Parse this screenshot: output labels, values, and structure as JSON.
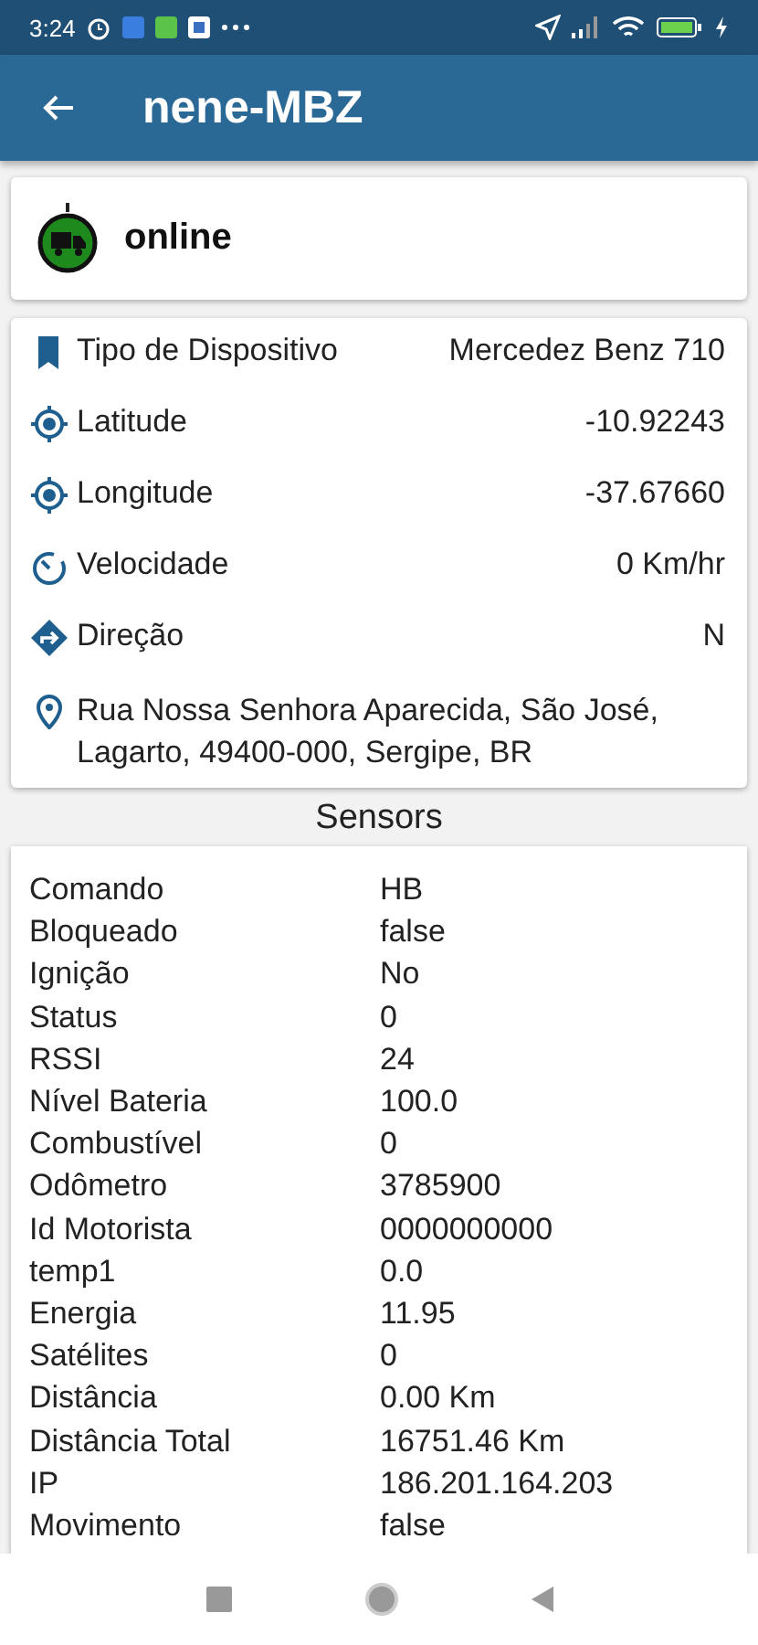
{
  "status_bar": {
    "time": "3:24"
  },
  "app_bar": {
    "title": "nene-MBZ"
  },
  "status_card": {
    "status": "online",
    "online": true
  },
  "details": [
    {
      "kind": "bookmark",
      "label": "Tipo de Dispositivo",
      "value": "Mercedez Benz 710"
    },
    {
      "kind": "target",
      "label": "Latitude",
      "value": "-10.92243"
    },
    {
      "kind": "target",
      "label": "Longitude",
      "value": "-37.67660"
    },
    {
      "kind": "speed",
      "label": "Velocidade",
      "value": "0 Km/hr"
    },
    {
      "kind": "direction",
      "label": "Direção",
      "value": "N"
    },
    {
      "kind": "pin",
      "label": "Rua Nossa Senhora Aparecida, São José, Lagarto, 49400-000, Sergipe, BR"
    }
  ],
  "sensors": {
    "title": "Sensors",
    "rows": [
      {
        "label": "Comando",
        "value": "HB"
      },
      {
        "label": "Bloqueado",
        "value": "false"
      },
      {
        "label": "Ignição",
        "value": "No"
      },
      {
        "label": "Status",
        "value": "0"
      },
      {
        "label": "RSSI",
        "value": "24"
      },
      {
        "label": "Nível Bateria",
        "value": "100.0"
      },
      {
        "label": "Combustível",
        "value": "0"
      },
      {
        "label": "Odômetro",
        "value": "3785900"
      },
      {
        "label": "Id Motorista",
        "value": "0000000000"
      },
      {
        "label": "temp1",
        "value": "0.0"
      },
      {
        "label": "Energia",
        "value": "11.95"
      },
      {
        "label": "Satélites",
        "value": "0"
      },
      {
        "label": "Distância",
        "value": "0.00 Km"
      },
      {
        "label": "Distância Total",
        "value": "16751.46 Km"
      },
      {
        "label": "IP",
        "value": "186.201.164.203"
      },
      {
        "label": "Movimento",
        "value": "false"
      }
    ]
  }
}
